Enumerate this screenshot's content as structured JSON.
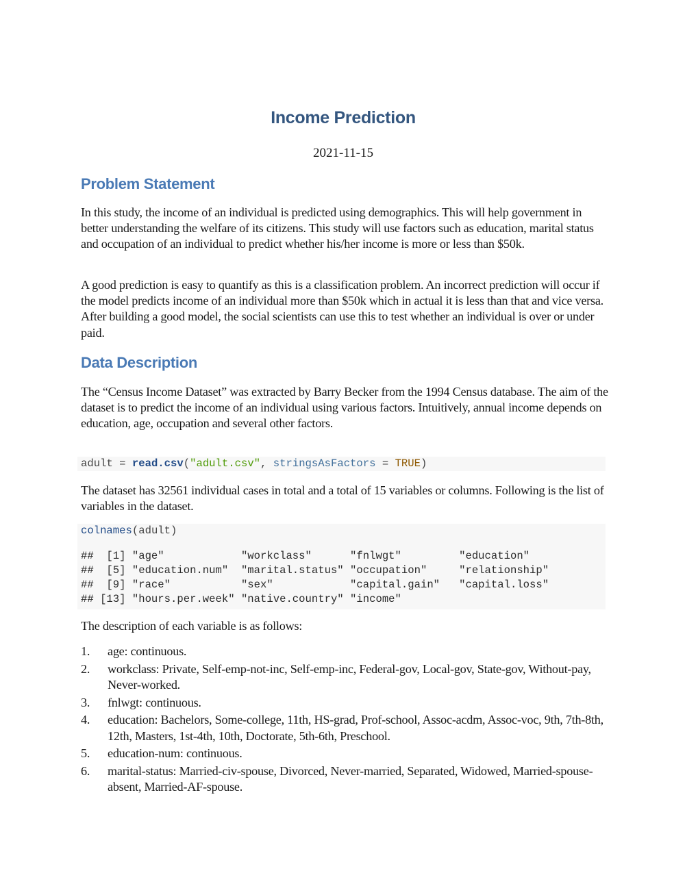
{
  "document": {
    "title": "Income Prediction",
    "date": "2021-11-15"
  },
  "sections": {
    "problem": {
      "heading": "Problem Statement",
      "paragraphs": [
        "In this study, the income of an individual is predicted using demographics. This will help government in better understanding the welfare of its citizens. This study will use factors such as education, marital status and occupation of an individual to predict whether his/her income is more or less than $50k.",
        "A good prediction is easy to quantify as this is a classification problem. An incorrect prediction will occur if the model predicts income of an individual more than $50k which in actual it is less than that and vice versa. After building a good model, the social scientists can use this to test whether an individual is over or under paid."
      ]
    },
    "data": {
      "heading": "Data Description",
      "intro": "The “Census Income Dataset” was extracted by Barry Becker from the 1994 Census database. The aim of the dataset is to predict the income of an individual using various factors. Intuitively, annual income depends on education, age, occupation and several other factors.",
      "code1": {
        "var": "adult",
        "assign": " = ",
        "fn": "read.csv",
        "open": "(",
        "str": "\"adult.csv\"",
        "comma": ", ",
        "arg": "stringsAsFactors",
        "eq": " = ",
        "const": "TRUE",
        "close": ")"
      },
      "summary": "The dataset has 32561 individual cases in total and a total of 15 variables or columns. Following is the list of variables in the dataset.",
      "code2": {
        "fn": "colnames",
        "rest": "(adult)"
      },
      "output_lines": [
        "##  [1] \"age\"            \"workclass\"      \"fnlwgt\"         \"education\"",
        "##  [5] \"education.num\"  \"marital.status\" \"occupation\"     \"relationship\"",
        "##  [9] \"race\"           \"sex\"            \"capital.gain\"   \"capital.loss\"",
        "## [13] \"hours.per.week\" \"native.country\" \"income\""
      ],
      "list_intro": "The description of each variable is as follows:",
      "variables": [
        {
          "num": "1.",
          "text": "age: continuous."
        },
        {
          "num": "2.",
          "text": "workclass: Private, Self-emp-not-inc, Self-emp-inc, Federal-gov, Local-gov, State-gov, Without-pay, Never-worked."
        },
        {
          "num": "3.",
          "text": "fnlwgt: continuous."
        },
        {
          "num": "4.",
          "text": "education: Bachelors, Some-college, 11th, HS-grad, Prof-school, Assoc-acdm, Assoc-voc, 9th, 7th-8th, 12th, Masters, 1st-4th, 10th, Doctorate, 5th-6th, Preschool."
        },
        {
          "num": "5.",
          "text": "education-num: continuous."
        },
        {
          "num": "6.",
          "text": "marital-status: Married-civ-spouse, Divorced, Never-married, Separated, Widowed, Married-spouse-absent, Married-AF-spouse."
        }
      ]
    }
  }
}
